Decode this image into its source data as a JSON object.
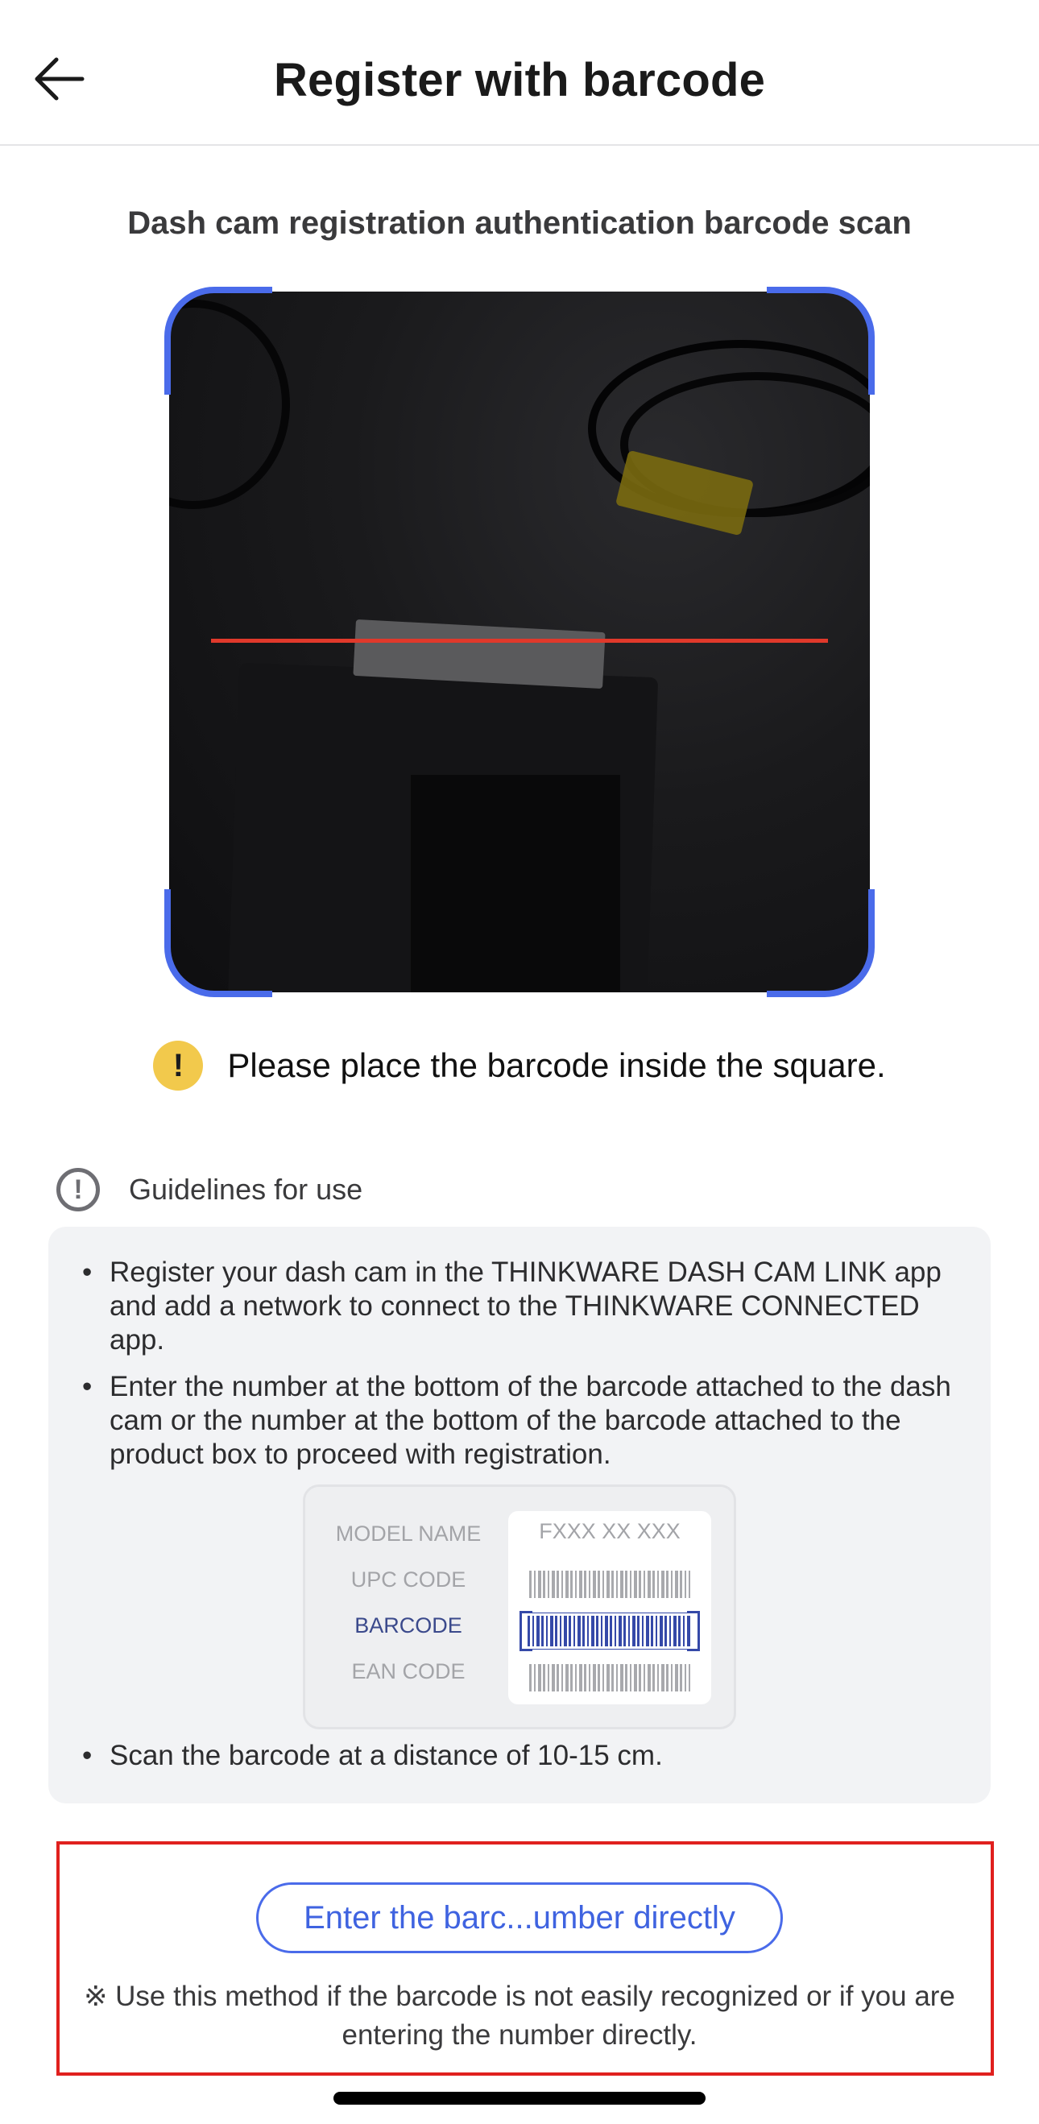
{
  "header": {
    "back_icon": "arrow-left-icon",
    "title": "Register with barcode"
  },
  "scan": {
    "subtitle": "Dash cam registration authentication barcode scan",
    "hint": "Please place the barcode inside the square.",
    "hint_icon_glyph": "!"
  },
  "guidelines": {
    "title": "Guidelines for use",
    "info_icon_glyph": "!",
    "items": [
      "Register your dash cam in the THINKWARE DASH CAM LINK app and add a network to connect to the THINKWARE CONNECTED app.",
      "Enter the number at the bottom of the barcode attached to the dash cam or the number at the bottom of the barcode attached to the product box to proceed with registration.",
      "Scan the barcode at a distance of 10-15 cm."
    ],
    "sample": {
      "labels": [
        "MODEL NAME",
        "UPC CODE",
        "BARCODE",
        "EAN CODE"
      ],
      "model_value": "FXXX XX XXX"
    }
  },
  "manual_entry": {
    "button_label": "Enter the barc...umber directly",
    "note": "※ Use this method if the barcode is not easily recognized or if you are entering the number directly."
  },
  "colors": {
    "accent": "#4a6bea",
    "scan_line": "#e0392b",
    "warning": "#f2c94c",
    "highlight": "#e0201e"
  }
}
